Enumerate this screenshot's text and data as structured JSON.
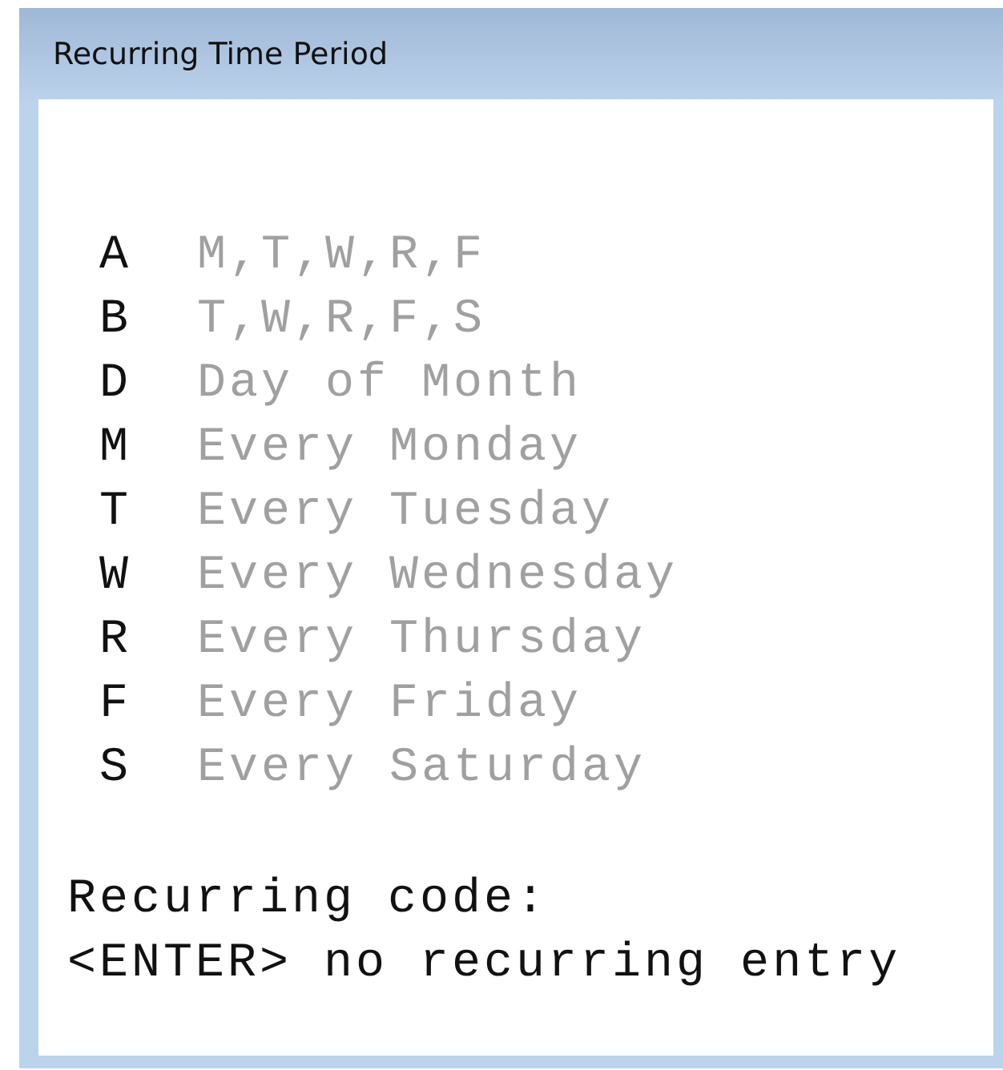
{
  "window": {
    "title": "Recurring Time Period"
  },
  "codes": [
    {
      "code": "A",
      "description": "M,T,W,R,F"
    },
    {
      "code": "B",
      "description": "T,W,R,F,S"
    },
    {
      "code": "D",
      "description": "Day of Month"
    },
    {
      "code": "M",
      "description": "Every Monday"
    },
    {
      "code": "T",
      "description": "Every Tuesday"
    },
    {
      "code": "W",
      "description": "Every Wednesday"
    },
    {
      "code": "R",
      "description": "Every Thursday"
    },
    {
      "code": "F",
      "description": "Every Friday"
    },
    {
      "code": "S",
      "description": "Every Saturday"
    }
  ],
  "prompt": {
    "label": "Recurring code:",
    "hint": "<ENTER> no recurring entry"
  }
}
